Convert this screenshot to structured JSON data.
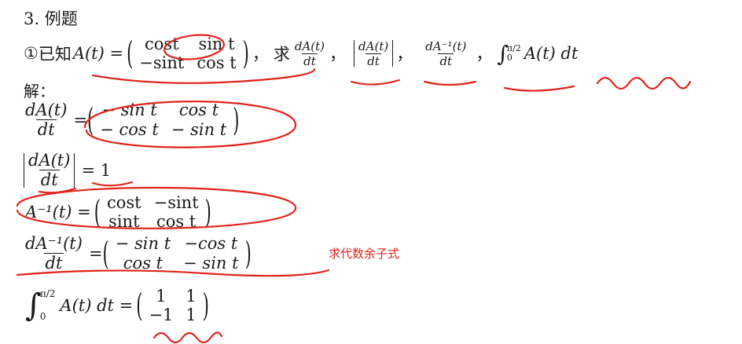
{
  "heading": "3. 例题",
  "problem": {
    "number": "①",
    "prefix": "已知",
    "func": "A(t) =",
    "matrix": [
      [
        "cost",
        "sin t"
      ],
      [
        "−sint",
        "cos t"
      ]
    ],
    "sep1": "，",
    "ask": "求",
    "d1_num": "dA(t)",
    "d1_den": "dt",
    "sep2": "，",
    "d2_num": "dA(t)",
    "d2_den": "dt",
    "sep3": "，",
    "d3_num": "dA⁻¹(t)",
    "d3_den": "dt",
    "sep4": "，",
    "int_upper": "π/2",
    "int_lower": "0",
    "int_body": "A(t) dt"
  },
  "solution_label": "解：",
  "step1": {
    "num": "dA(t)",
    "den": "dt",
    "eq": "=",
    "matrix": [
      [
        "− sin t",
        "cos t"
      ],
      [
        "− cos t",
        "− sin t"
      ]
    ]
  },
  "step2": {
    "num": "dA(t)",
    "den": "dt",
    "rhs": "= 1"
  },
  "step3": {
    "lhs": "A⁻¹(t) =",
    "matrix": [
      [
        "cost",
        "−sint"
      ],
      [
        "sint",
        "cos t"
      ]
    ]
  },
  "step4": {
    "num": "dA⁻¹(t)",
    "den": "dt",
    "eq": "=",
    "matrix": [
      [
        "− sin t",
        "−cos t"
      ],
      [
        "cos t",
        "− sin t"
      ]
    ],
    "note": "求代数余子式"
  },
  "step5": {
    "int_upper": "π/2",
    "int_lower": "0",
    "body": "A(t) dt =",
    "matrix": [
      [
        "1",
        "1"
      ],
      [
        "−1",
        "1"
      ]
    ]
  },
  "colors": {
    "ink": "#1a1a1a",
    "annotation_red": "#e0241b"
  }
}
